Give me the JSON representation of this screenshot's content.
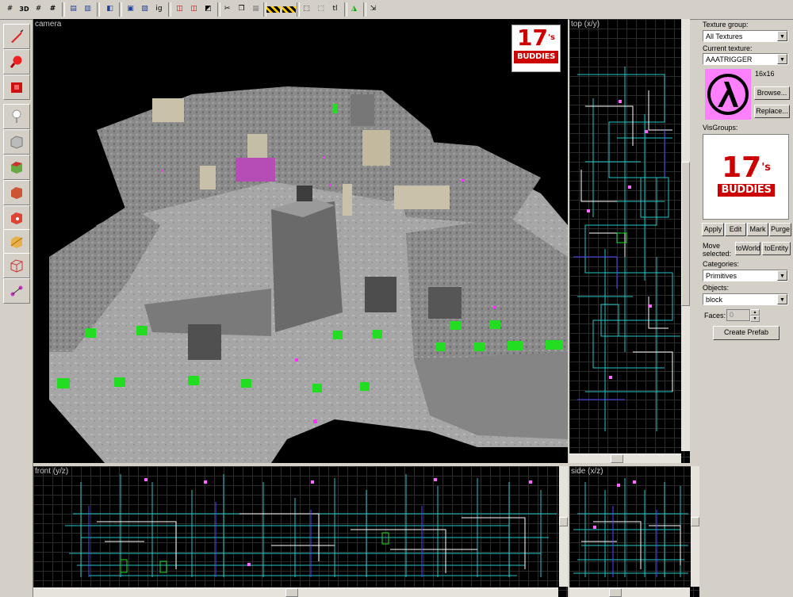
{
  "toolbar": {
    "icons": [
      "grid-icon",
      "3d-grid-icon",
      "smaller-grid-icon",
      "larger-grid-icon",
      "load-pointfile-icon",
      "unload-pointfile-icon",
      "carve-icon",
      "group-icon",
      "ungroup-icon",
      "ignore-groups-icon",
      "hide-items-icon",
      "show-items-icon",
      "edit-cordon-icon",
      "cut-icon",
      "copy-icon",
      "paste-icon",
      "toggle-texture-lock-icon",
      "texture-lock-scale-icon",
      "toggle-select-by-handles-icon",
      "select-by-center-icon",
      "select-entity-icon",
      "texture-application-icon",
      "run-map-icon"
    ],
    "labels": {
      "ig": "ig",
      "tl": "tl",
      "3d": "3D"
    }
  },
  "left_tools": [
    "selection-tool-icon",
    "magnify-tool-icon",
    "camera-tool-icon",
    "entity-tool-icon",
    "block-tool-icon",
    "texture-application-tool-icon",
    "apply-current-texture-icon",
    "decal-tool-icon",
    "clipping-tool-icon",
    "vertex-manipulation-tool-icon",
    "path-tool-icon"
  ],
  "viewports": {
    "camera": {
      "label": "camera"
    },
    "top": {
      "label": "top (x/y)"
    },
    "front": {
      "label": "front (y/z)"
    },
    "side": {
      "label": "side (x/z)"
    }
  },
  "logo": {
    "number": "17",
    "suffix": "'s",
    "word": "BUDDIES"
  },
  "right_panel": {
    "texture_group_label": "Texture group:",
    "texture_group_value": "All Textures",
    "current_texture_label": "Current texture:",
    "current_texture_value": "AAATRIGGER",
    "texture_size": "16x16",
    "browse_label": "Browse...",
    "replace_label": "Replace...",
    "visgroups_label": "VisGroups:",
    "apply_label": "Apply",
    "edit_label": "Edit",
    "mark_label": "Mark",
    "purge_label": "Purge",
    "move_selected_label_1": "Move",
    "move_selected_label_2": "selected:",
    "to_world_label": "toWorld",
    "to_entity_label": "toEntity",
    "categories_label": "Categories:",
    "categories_value": "Primitives",
    "objects_label": "Objects:",
    "objects_value": "block",
    "faces_label": "Faces:",
    "faces_value": "0",
    "create_prefab_label": "Create Prefab"
  },
  "colors": {
    "face_background": "#d4d0c8",
    "viewport_bg": "#000000",
    "trigger_pink": "#ff66ff",
    "green_entity": "#22dd22"
  }
}
